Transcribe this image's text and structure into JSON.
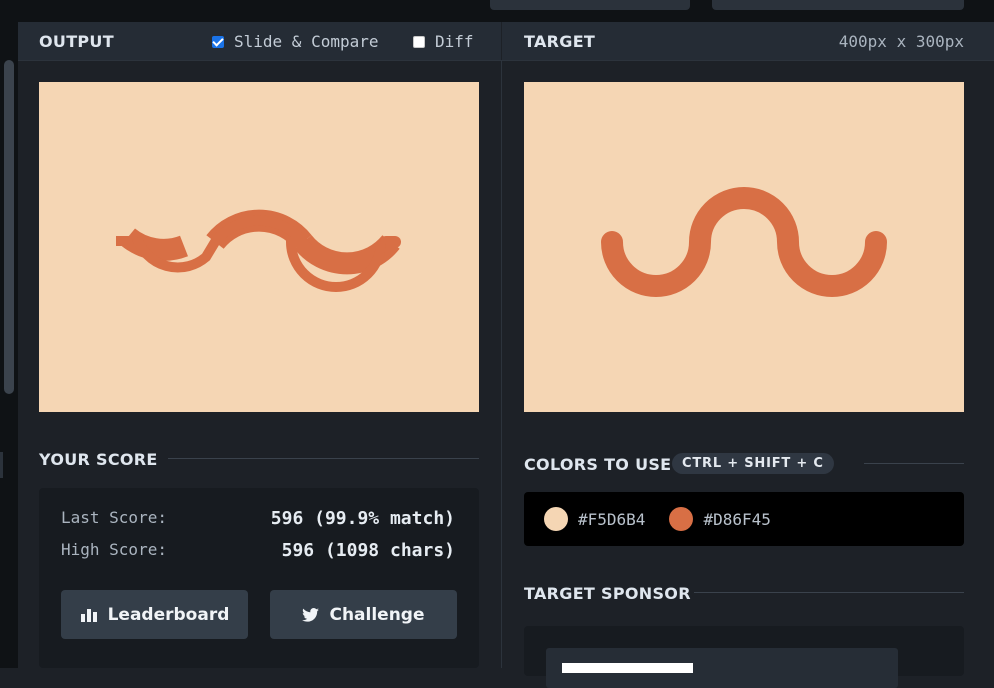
{
  "output": {
    "title": "OUTPUT",
    "slide_compare_label": "Slide & Compare",
    "slide_compare_checked": true,
    "diff_label": "Diff",
    "diff_checked": false
  },
  "target": {
    "title": "TARGET",
    "dimensions": "400px x 300px"
  },
  "score": {
    "title": "YOUR SCORE",
    "last_label": "Last Score:",
    "last_value": "596 (99.9% match)",
    "high_label": "High Score:",
    "high_value": "596 (1098 chars)",
    "leaderboard_label": "Leaderboard",
    "challenge_label": "Challenge"
  },
  "colors": {
    "title": "COLORS TO USE",
    "shortcut": "CTRL + SHIFT + C",
    "items": [
      {
        "hex": "#F5D6B4",
        "color": "#F5D6B4"
      },
      {
        "hex": "#D86F45",
        "color": "#D86F45"
      }
    ]
  },
  "sponsor": {
    "title": "TARGET SPONSOR"
  },
  "icons": {
    "leaderboard": "bar-chart-icon",
    "challenge": "twitter-bird-icon"
  }
}
